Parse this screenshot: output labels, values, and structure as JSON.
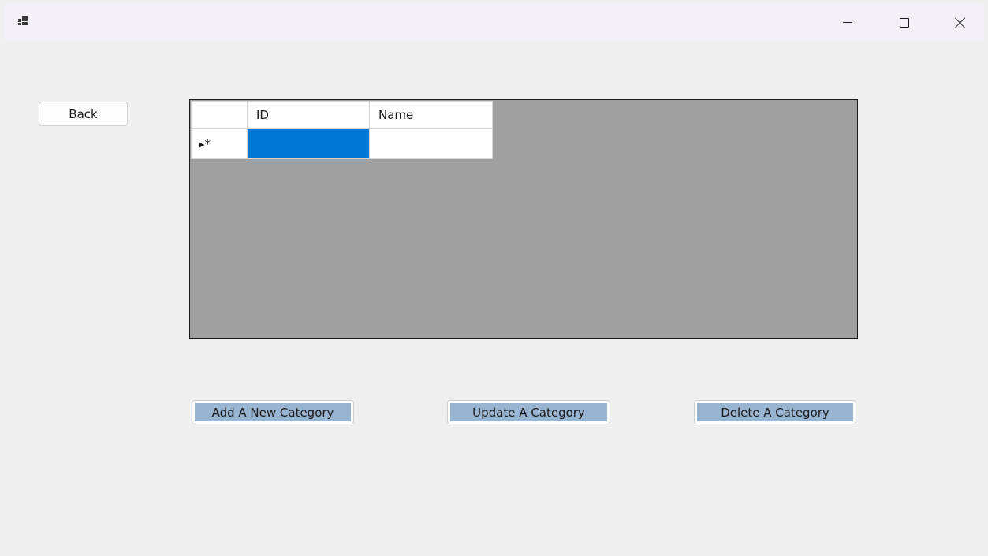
{
  "window": {
    "icon": "app-icon",
    "caption_buttons": {
      "minimize_icon": "minimize-icon",
      "maximize_icon": "maximize-icon",
      "close_icon": "close-icon"
    }
  },
  "back_button": {
    "label": "Back"
  },
  "grid": {
    "columns": [
      "ID",
      "Name"
    ],
    "new_row_indicator": "▸*",
    "rows": [
      {
        "id": "",
        "name": ""
      }
    ],
    "colors": {
      "background": "#a0a0a0",
      "selected_cell": "#0078d7"
    }
  },
  "actions": {
    "add_label": "Add A New Category",
    "update_label": "Update A Category",
    "delete_label": "Delete A Category",
    "button_fill": "#99b4d1"
  }
}
